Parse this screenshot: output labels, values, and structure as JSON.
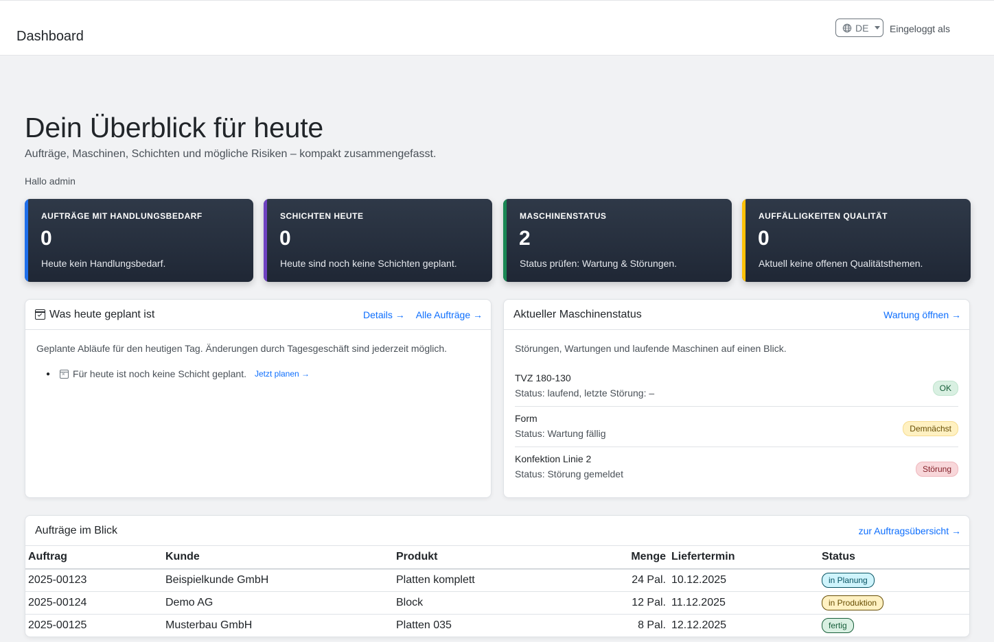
{
  "topbar": {
    "title": "Dashboard",
    "language": "DE",
    "login_text": "Eingeloggt als"
  },
  "hero": {
    "title": "Dein Überblick für heute",
    "subtitle": "Aufträge, Maschinen, Schichten und mögliche Risiken – kompakt zusammengefasst.",
    "greeting": "Hallo admin"
  },
  "kpis": [
    {
      "label": "AUFTRÄGE MIT HANDLUNGSBEDARF",
      "value": "0",
      "text": "Heute kein Handlungsbedarf.",
      "accent": "#1f6feb"
    },
    {
      "label": "SCHICHTEN HEUTE",
      "value": "0",
      "text": "Heute sind noch keine Schichten geplant.",
      "accent": "#6f42c1"
    },
    {
      "label": "MASCHINENSTATUS",
      "value": "2",
      "text": "Status prüfen: Wartung & Störungen.",
      "accent": "#198754"
    },
    {
      "label": "AUFFÄLLIGKEITEN QUALITÄT",
      "value": "0",
      "text": "Aktuell keine offenen Qualitätsthemen.",
      "accent": "#ffc107"
    }
  ],
  "plan_card": {
    "title": "Was heute geplant ist",
    "link_details": "Details →",
    "link_all": "Alle Aufträge →",
    "description": "Geplante Abläufe für den heutigen Tag. Änderungen durch Tagesgeschäft sind jederzeit möglich.",
    "item_text": "Für heute ist noch keine Schicht geplant.",
    "item_link": "Jetzt planen →"
  },
  "machine_card": {
    "title": "Aktueller Maschinenstatus",
    "link": "Wartung öffnen →",
    "description": "Störungen, Wartungen und laufende Maschinen auf einen Blick.",
    "machines": [
      {
        "name": "TVZ 180-130",
        "status": "Status: laufend, letzte Störung: –",
        "badge": "OK"
      },
      {
        "name": "Form",
        "status": "Status: Wartung fällig",
        "badge": "Demnächst"
      },
      {
        "name": "Konfektion Linie 2",
        "status": "Status: Störung gemeldet",
        "badge": "Störung"
      }
    ]
  },
  "orders_card": {
    "title": "Aufträge im Blick",
    "link": "zur Auftragsübersicht →",
    "columns": [
      "Auftrag",
      "Kunde",
      "Produkt",
      "Menge",
      "Liefertermin",
      "Status"
    ],
    "rows": [
      {
        "order": "2025-00123",
        "customer": "Beispielkunde GmbH",
        "product": "Platten komplett",
        "qty": "24 Pal.",
        "date": "10.12.2025",
        "status": "in Planung"
      },
      {
        "order": "2025-00124",
        "customer": "Demo AG",
        "product": "Block",
        "qty": "12 Pal.",
        "date": "11.12.2025",
        "status": "in Produktion"
      },
      {
        "order": "2025-00125",
        "customer": "Musterbau GmbH",
        "product": "Platten 035",
        "qty": "8 Pal.",
        "date": "12.12.2025",
        "status": "fertig"
      }
    ]
  }
}
